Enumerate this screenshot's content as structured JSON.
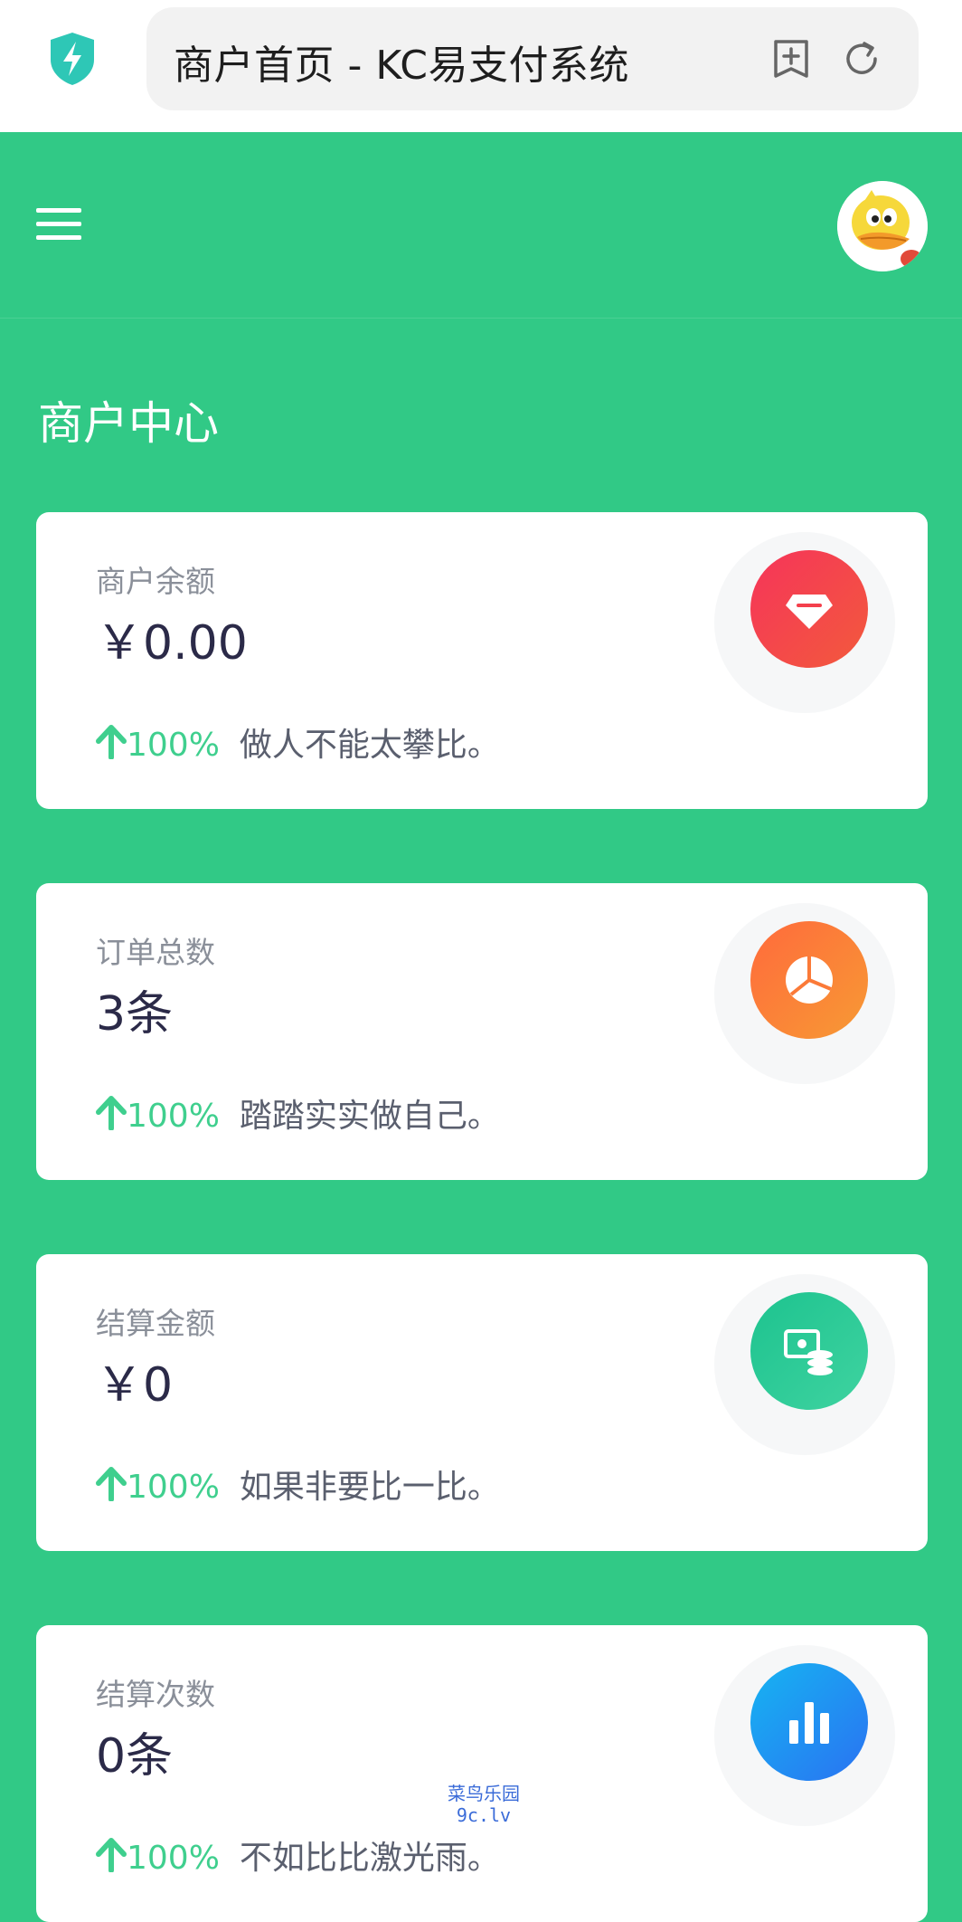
{
  "browser": {
    "title": "商户首页 - KC易支付系统",
    "icons": {
      "logo": "shield-bolt-icon",
      "bookmark": "add-bookmark-icon",
      "reload": "reload-icon"
    }
  },
  "header": {
    "menu_icon": "hamburger-menu-icon",
    "avatar": "duck-avatar"
  },
  "section_title": "商户中心",
  "cards": [
    {
      "label": "商户余额",
      "value": "￥0.00",
      "trend": "100%",
      "note": "做人不能太攀比。",
      "icon": "diamond-icon",
      "colors": [
        "#f6345a",
        "#f25a3c"
      ]
    },
    {
      "label": "订单总数",
      "value": "3条",
      "trend": "100%",
      "note": "踏踏实实做自己。",
      "icon": "pie-chart-icon",
      "colors": [
        "#ff6a3c",
        "#f79a34"
      ]
    },
    {
      "label": "结算金额",
      "value": "￥0",
      "trend": "100%",
      "note": "如果非要比一比。",
      "icon": "money-coins-icon",
      "colors": [
        "#1dc38f",
        "#3fd3a0"
      ]
    },
    {
      "label": "结算次数",
      "value": "0条",
      "trend": "100%",
      "note": "不如比比激光雨。",
      "icon": "bar-chart-icon",
      "colors": [
        "#16b4f2",
        "#2a72f2"
      ]
    }
  ],
  "watermark": {
    "line1": "菜鸟乐园",
    "line2": "9c.lv"
  },
  "colors": {
    "primary": "#31c986",
    "trend": "#3fcf8e"
  }
}
